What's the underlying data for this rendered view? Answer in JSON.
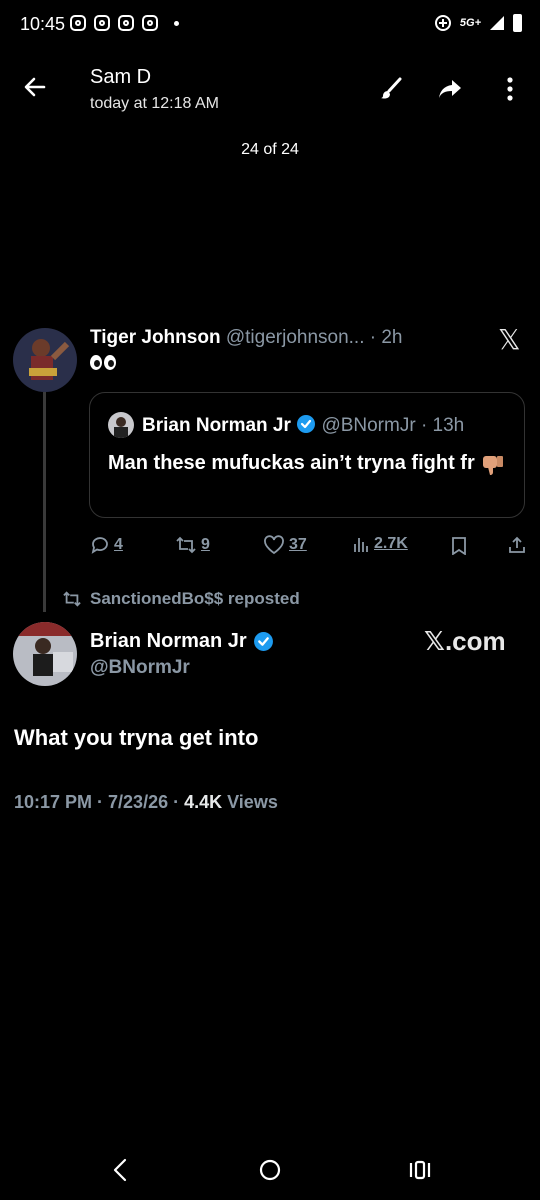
{
  "status_bar": {
    "time": "10:45",
    "network": "5G+"
  },
  "viewer": {
    "sender": "Sam D",
    "timestamp": "today at 12:18 AM",
    "counter": "24 of 24"
  },
  "tweet1": {
    "name": "Tiger Johnson",
    "handle_time": "@tigerjohnson... · 2h",
    "x_logo": "𝕏",
    "quote": {
      "name": "Brian Norman Jr",
      "handle_time": "@BNormJr · 13h",
      "text": "Man these mufuckas ain’t tryna fight fr"
    },
    "actions": {
      "replies": "4",
      "reposts": "9",
      "likes": "37",
      "views": "2.7K"
    }
  },
  "repost_label": "SanctionedBo$$ reposted",
  "main_tweet": {
    "name": "Brian Norman Jr",
    "handle": "@BNormJr",
    "brand": "𝕏.com",
    "text": "What you tryna get into",
    "time": "10:17 PM · 7/23/26 · ",
    "views_count": "4.4K",
    "views_label": " Views"
  },
  "colors": {
    "background": "#000000",
    "muted": "#8b98a5",
    "verified": "#1d9bf0"
  },
  "icons": [
    "instagram-icon",
    "back-arrow-icon",
    "brush-icon",
    "share-icon",
    "more-icon",
    "reply-icon",
    "repost-icon",
    "like-icon",
    "views-icon",
    "bookmark-icon",
    "upload-icon",
    "verified-icon",
    "nav-back-icon",
    "nav-home-icon",
    "nav-recents-icon"
  ]
}
